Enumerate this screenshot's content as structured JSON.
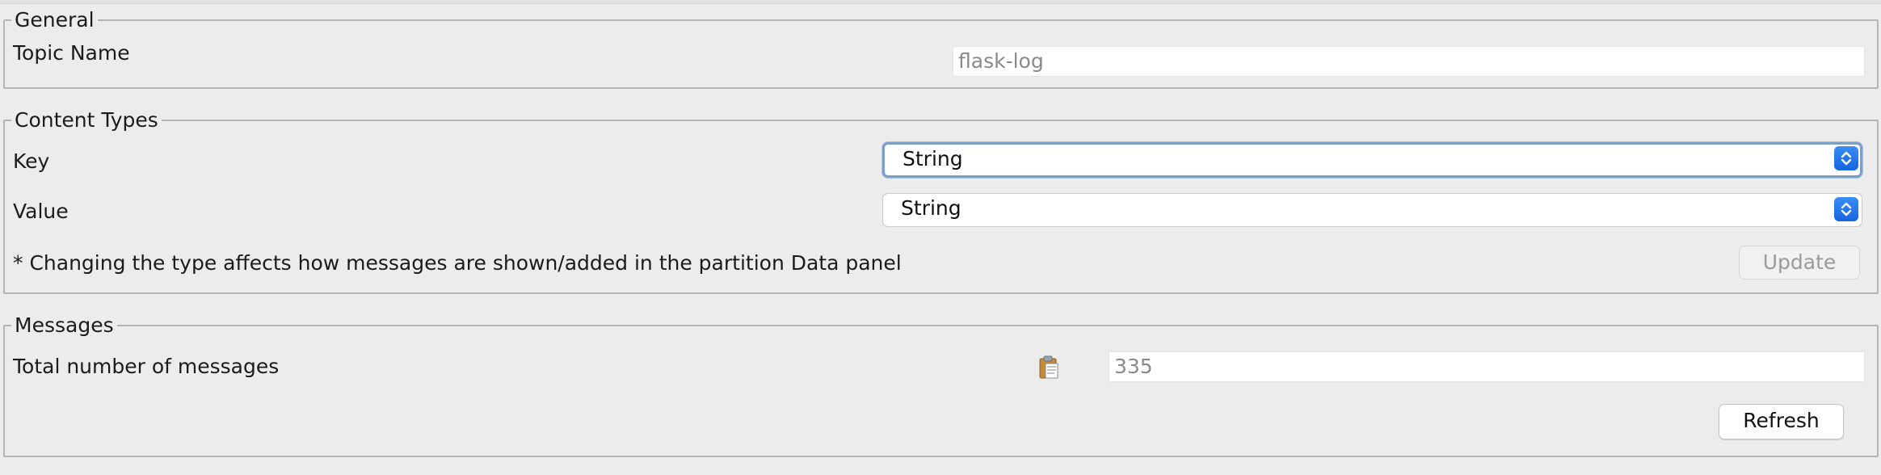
{
  "general": {
    "legend": "General",
    "topic_name_label": "Topic Name",
    "topic_name_value": "flask-log"
  },
  "content_types": {
    "legend": "Content Types",
    "key_label": "Key",
    "key_value": "String",
    "value_label": "Value",
    "value_value": "String",
    "note": "* Changing the type affects how messages are shown/added in the partition Data panel",
    "update_label": "Update"
  },
  "messages": {
    "legend": "Messages",
    "total_label": "Total number of messages",
    "total_value": "335",
    "refresh_label": "Refresh"
  },
  "icons": {
    "dropdown": "chevron-updown-icon",
    "copy": "clipboard-icon"
  },
  "colors": {
    "accent": "#1f6fe8",
    "background": "#ececec"
  }
}
